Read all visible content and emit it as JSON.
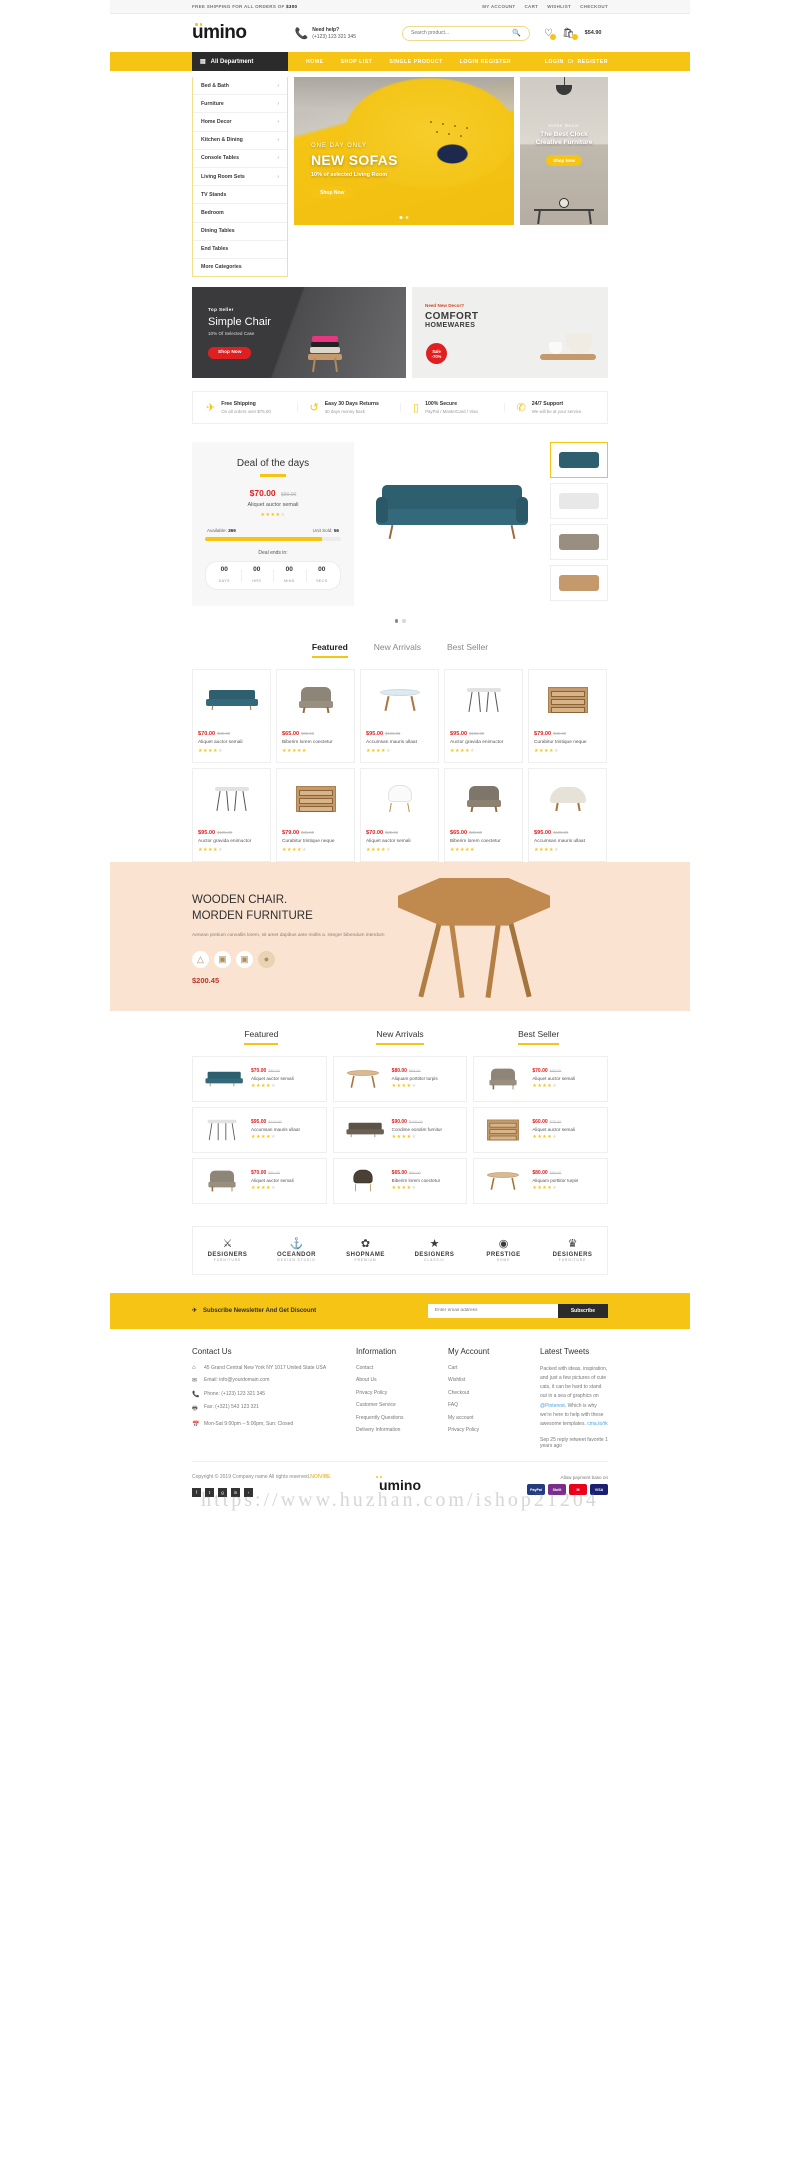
{
  "topbar": {
    "shipping_prefix": "FREE SHIPPING FOR ALL ORDERS OF",
    "shipping_amount": "$300",
    "links": [
      "MY ACCOUNT",
      "CART",
      "WISHLIST",
      "CHECKOUT"
    ]
  },
  "header": {
    "logo": "umino",
    "help_title": "Need help?",
    "help_phone": "(+123) 123 321 345",
    "search_placeholder": "Search product...",
    "cart_total": "$54.90"
  },
  "nav": {
    "department_label": "All Department",
    "links": [
      "HOME",
      "SHOP LIST",
      "SINGLE PRODUCT",
      "LOGIN REGISTER"
    ],
    "right": {
      "login": "LOGIN",
      "or": "Or",
      "register": "REGISTER"
    }
  },
  "departments": [
    {
      "label": "Bed & Bath",
      "arrow": true
    },
    {
      "label": "Furniture",
      "arrow": true
    },
    {
      "label": "Home Decor",
      "arrow": true
    },
    {
      "label": "Kitchen & Dining",
      "arrow": true
    },
    {
      "label": "Console Tables",
      "arrow": true
    },
    {
      "label": "Living Room Sets",
      "arrow": true
    },
    {
      "label": "TV Stands",
      "arrow": false
    },
    {
      "label": "Bedroom",
      "arrow": false
    },
    {
      "label": "Dining Tables",
      "arrow": false
    },
    {
      "label": "End Tables",
      "arrow": false
    },
    {
      "label": "More Categories",
      "arrow": false
    }
  ],
  "hero": {
    "eyebrow": "ONE DAY ONLY",
    "title": "NEW SOFAS",
    "subtitle": "10% of selected Living Room",
    "button": "Shop Now"
  },
  "hero_side": {
    "eyebrow": "Home Decor",
    "title": "The Best Clock\nCreative Furniture",
    "button": "Shop Now"
  },
  "promo_left": {
    "eyebrow": "Top Seller",
    "title": "Simple Chair",
    "subtitle": "10% Of Selected Case",
    "button": "Shop Now"
  },
  "promo_right": {
    "eyebrow": "Need New Decor?",
    "title": "COMFORT",
    "subtitle": "HOMEWARES",
    "badge_line1": "Sale",
    "badge_line2": "-70%"
  },
  "services": [
    {
      "icon": "plane-icon",
      "title": "Free Shipping",
      "desc": "On all orders over $75.00"
    },
    {
      "icon": "return-icon",
      "title": "Easy 30 Days Returns",
      "desc": "30 days money back"
    },
    {
      "icon": "card-icon",
      "title": "100% Secure",
      "desc": "PayPal / MasterCard / Visa"
    },
    {
      "icon": "support-icon",
      "title": "24/7 Support",
      "desc": "We will be at your service"
    }
  ],
  "deal": {
    "title": "Deal of the days",
    "price": "$70.00",
    "old_price": "$80.00",
    "name": "Aliquet auctor semali",
    "available_label": "Available:",
    "available_value": "369",
    "sold_label": "Unit Sold:",
    "sold_value": "56",
    "progress_percent": 86,
    "ends_label": "Deal ends in:",
    "countdown": [
      {
        "value": "00",
        "unit": "DAYS"
      },
      {
        "value": "00",
        "unit": "HRS"
      },
      {
        "value": "00",
        "unit": "MINS"
      },
      {
        "value": "00",
        "unit": "SECS"
      }
    ]
  },
  "tabs": [
    "Featured",
    "New Arrivals",
    "Best Seller"
  ],
  "products": [
    {
      "price": "$70.00",
      "old": "$80.00",
      "name": "Aliquet auctor semali",
      "rating": 4,
      "shape": "sofa"
    },
    {
      "price": "$65.00",
      "old": "$80.00",
      "name": "Biberim lorem coectetur",
      "rating": 5,
      "shape": "chair"
    },
    {
      "price": "$95.00",
      "old": "$100.00",
      "name": "Accumsan mauris ullaat",
      "rating": 4,
      "shape": "table"
    },
    {
      "price": "$95.00",
      "old": "$105.00",
      "name": "Auctor gravida enimuctor",
      "rating": 4,
      "shape": "hair"
    },
    {
      "price": "$79.00",
      "old": "$95.00",
      "name": "Curabitur tristique neque",
      "rating": 4,
      "shape": "shelf"
    },
    {
      "price": "$95.00",
      "old": "$105.00",
      "name": "Auctor gravida enimuctor",
      "rating": 4,
      "shape": "hair"
    },
    {
      "price": "$79.00",
      "old": "$95.00",
      "name": "Curabitur tristique neque",
      "rating": 4,
      "shape": "shelf"
    },
    {
      "price": "$70.00",
      "old": "$80.00",
      "name": "Aliquet auctor semali",
      "rating": 4,
      "shape": "white"
    },
    {
      "price": "$65.00",
      "old": "$80.00",
      "name": "Biberim lorem coectetur",
      "rating": 5,
      "shape": "chair"
    },
    {
      "price": "$95.00",
      "old": "$100.00",
      "name": "Accumsan mauris ullaat",
      "rating": 4,
      "shape": "lounge"
    }
  ],
  "wood_banner": {
    "title_line1": "WOODEN CHAIR.",
    "title_line2": "MORDEN FURNITURE",
    "description": "Aenean pretium convallis lorem, sit amet dapibus ante mollis a. integer bibendum interdum",
    "price": "$200.45",
    "swatch_count": 4
  },
  "col_tabs": [
    "Featured",
    "New Arrivals",
    "Best Seller"
  ],
  "col_lists": [
    [
      {
        "price": "$70.00",
        "old": "$80.00",
        "name": "Aliquet auctor semali",
        "rating": 4,
        "shape": "sofa"
      },
      {
        "price": "$95.00",
        "old": "$110.00",
        "name": "Accumsan mauris ullaat",
        "rating": 4,
        "shape": "hair"
      },
      {
        "price": "$70.00",
        "old": "$80.00",
        "name": "Aliquet auctor semali",
        "rating": 4,
        "shape": "chair"
      }
    ],
    [
      {
        "price": "$80.00",
        "old": "$95.00",
        "name": "Aliquam porttitor turpis",
        "rating": 4,
        "shape": "table"
      },
      {
        "price": "$90.00",
        "old": "$105.00",
        "name": "Condime eondim furnitur",
        "rating": 4,
        "shape": "sofa"
      },
      {
        "price": "$65.00",
        "old": "$80.00",
        "name": "Biberim lorem coectetur",
        "rating": 4,
        "shape": "white"
      }
    ],
    [
      {
        "price": "$70.00",
        "old": "$85.00",
        "name": "Aliquet auctor semali",
        "rating": 4,
        "shape": "chair"
      },
      {
        "price": "$60.00",
        "old": "$75.00",
        "name": "Aliquet auctor semali",
        "rating": 4,
        "shape": "shelf"
      },
      {
        "price": "$80.00",
        "old": "$95.00",
        "name": "Aliquam porttitor turpis",
        "rating": 4,
        "shape": "table"
      }
    ]
  ],
  "brands": [
    {
      "name": "DESIGNERS",
      "sub": "FURNITURE"
    },
    {
      "name": "OCEANDOR",
      "sub": "DESIGN STUDIO"
    },
    {
      "name": "SHOPNAME",
      "sub": "PREMIUM"
    },
    {
      "name": "DESIGNERS",
      "sub": "CLASSIC"
    },
    {
      "name": "PRESTIGE",
      "sub": "HOME"
    },
    {
      "name": "DESIGNERS",
      "sub": "FURNITURE"
    }
  ],
  "newsletter": {
    "title": "Subscribe Newsletter And Get Discount",
    "placeholder": "Enter email address",
    "button": "Subscribe"
  },
  "footer": {
    "contact": {
      "heading": "Contact Us",
      "address": "45 Grand Central New York NY 1017 United State USA",
      "email": "Email:  info@yourdomain.com",
      "phone": "Phone:  (+123) 123 321 345",
      "fax": "Fax:  (+321) 543 123 321",
      "hours": "Mon-Sat 9:00pm – 5:00pm, Sun: Closed"
    },
    "information": {
      "heading": "Information",
      "items": [
        "Contact",
        "About Us",
        "Privacy Policy",
        "Customer Service",
        "Frequently Questions",
        "Delivery Information"
      ]
    },
    "account": {
      "heading": "My Account",
      "items": [
        "Cart",
        "Wishlist",
        "Checkout",
        "FAQ",
        "My account",
        "Privacy Policy"
      ]
    },
    "tweets": {
      "heading": "Latest Tweets",
      "text_1": "Packed with ideas, inspiration, and just a few pictures of cute cats, it can be hard to stand out in a sea of graphics on ",
      "mention": "@Pinterest",
      "text_2": ". Which is why we're here to help with these awesome templates. ",
      "link": "cma.to/rk",
      "date": "Sep 25 reply retweet favorite 1 years ago"
    }
  },
  "foot_bottom": {
    "copyright_line1": "Copyright © 2019 Company name All rights",
    "copyright_line2": "reserved.",
    "copyright_brand": "NOIVIBE",
    "logo": "umino",
    "payment_label": "Allow payment baso on",
    "cards": [
      {
        "label": "PayPal",
        "color": "#253b80"
      },
      {
        "label": "Skrill",
        "color": "#7b2d8b"
      },
      {
        "label": "M",
        "color": "#eb001b"
      },
      {
        "label": "VISA",
        "color": "#1a1f71"
      }
    ],
    "social": [
      "f",
      "t",
      "g",
      "in",
      "r"
    ]
  },
  "watermark": "https://www.huzhan.com/ishop21204"
}
